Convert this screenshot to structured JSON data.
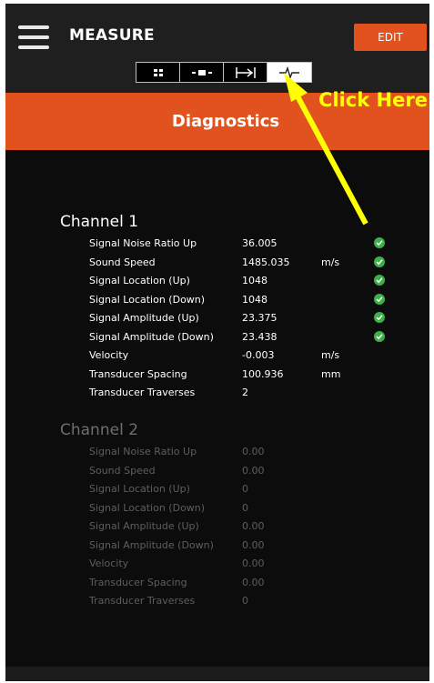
{
  "header": {
    "title": "MEASURE",
    "edit_label": "EDIT"
  },
  "tabs": [
    {
      "icon": "grid-icon",
      "active": false
    },
    {
      "icon": "bar-icon",
      "active": false
    },
    {
      "icon": "span-icon",
      "active": false
    },
    {
      "icon": "waveform-icon",
      "active": true
    }
  ],
  "banner": {
    "title": "Diagnostics"
  },
  "callout": {
    "text": "Click Here",
    "color": "#ffff00"
  },
  "colors": {
    "accent": "#e2521f",
    "ok": "#3db04a"
  },
  "channel1": {
    "title": "Channel 1",
    "rows": [
      {
        "label": "Signal Noise Ratio Up",
        "value": "36.005",
        "unit": "",
        "status": "ok"
      },
      {
        "label": "Sound Speed",
        "value": "1485.035",
        "unit": "m/s",
        "status": "ok"
      },
      {
        "label": "Signal Location (Up)",
        "value": "1048",
        "unit": "",
        "status": "ok"
      },
      {
        "label": "Signal Location (Down)",
        "value": "1048",
        "unit": "",
        "status": "ok"
      },
      {
        "label": "Signal Amplitude (Up)",
        "value": "23.375",
        "unit": "",
        "status": "ok"
      },
      {
        "label": "Signal Amplitude (Down)",
        "value": "23.438",
        "unit": "",
        "status": "ok"
      },
      {
        "label": "Velocity",
        "value": "-0.003",
        "unit": "m/s",
        "status": ""
      },
      {
        "label": "Transducer Spacing",
        "value": "100.936",
        "unit": "mm",
        "status": ""
      },
      {
        "label": "Transducer Traverses",
        "value": "2",
        "unit": "",
        "status": ""
      }
    ]
  },
  "channel2": {
    "title": "Channel 2",
    "rows": [
      {
        "label": "Signal Noise Ratio Up",
        "value": "0.00",
        "unit": "",
        "status": ""
      },
      {
        "label": "Sound Speed",
        "value": "0.00",
        "unit": "",
        "status": ""
      },
      {
        "label": "Signal Location (Up)",
        "value": "0",
        "unit": "",
        "status": ""
      },
      {
        "label": "Signal Location (Down)",
        "value": "0",
        "unit": "",
        "status": ""
      },
      {
        "label": "Signal Amplitude (Up)",
        "value": "0.00",
        "unit": "",
        "status": ""
      },
      {
        "label": "Signal Amplitude (Down)",
        "value": "0.00",
        "unit": "",
        "status": ""
      },
      {
        "label": "Velocity",
        "value": "0.00",
        "unit": "",
        "status": ""
      },
      {
        "label": "Transducer Spacing",
        "value": "0.00",
        "unit": "",
        "status": ""
      },
      {
        "label": "Transducer Traverses",
        "value": "0",
        "unit": "",
        "status": ""
      }
    ]
  }
}
